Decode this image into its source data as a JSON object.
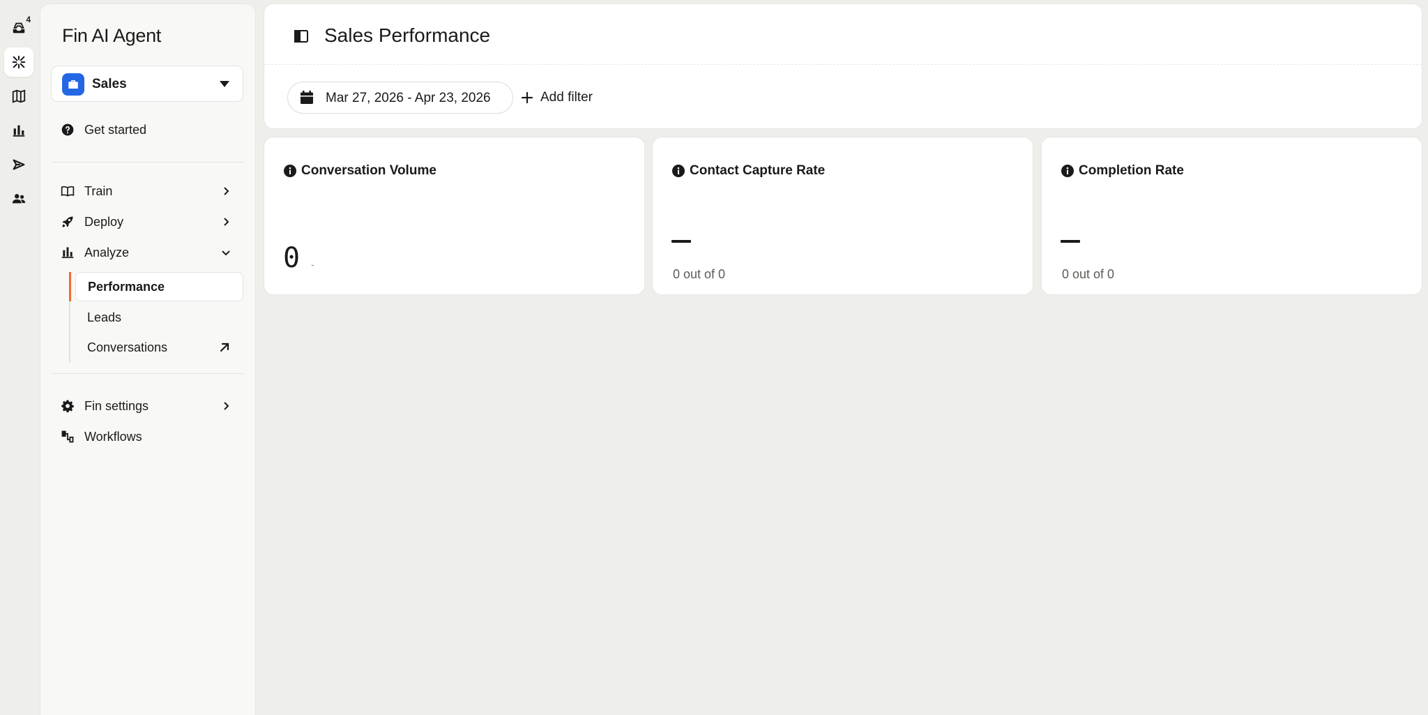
{
  "rail": {
    "inbox_badge": "4",
    "icons": [
      "inbox-icon",
      "fin-icon",
      "knowledge-icon",
      "reports-icon",
      "outbound-icon",
      "contacts-icon"
    ]
  },
  "sidebar": {
    "title": "Fin AI Agent",
    "agent_select": {
      "value": "Sales",
      "icon": "briefcase-icon",
      "color": "#2467e4"
    },
    "get_started": "Get started",
    "items": [
      {
        "label": "Train",
        "icon": "book-icon"
      },
      {
        "label": "Deploy",
        "icon": "rocket-icon"
      },
      {
        "label": "Analyze",
        "icon": "bar-chart-icon"
      }
    ],
    "analyze_sub": [
      {
        "label": "Performance",
        "active": true
      },
      {
        "label": "Leads",
        "active": false
      },
      {
        "label": "Conversations",
        "active": false,
        "external": true
      }
    ],
    "bottom": [
      {
        "label": "Fin settings",
        "icon": "gear-icon"
      },
      {
        "label": "Workflows",
        "icon": "workflow-icon"
      }
    ],
    "accent_color": "#ef6b32"
  },
  "header": {
    "title": "Sales Performance",
    "date_range": "Mar 27, 2026 - Apr 23, 2026",
    "add_filter": "Add filter"
  },
  "metrics": [
    {
      "title": "Conversation Volume",
      "value": "0",
      "delta": "-"
    },
    {
      "title": "Contact Capture Rate",
      "value": "—",
      "sub": "0 out of 0"
    },
    {
      "title": "Completion Rate",
      "value": "—",
      "sub": "0 out of 0"
    }
  ]
}
